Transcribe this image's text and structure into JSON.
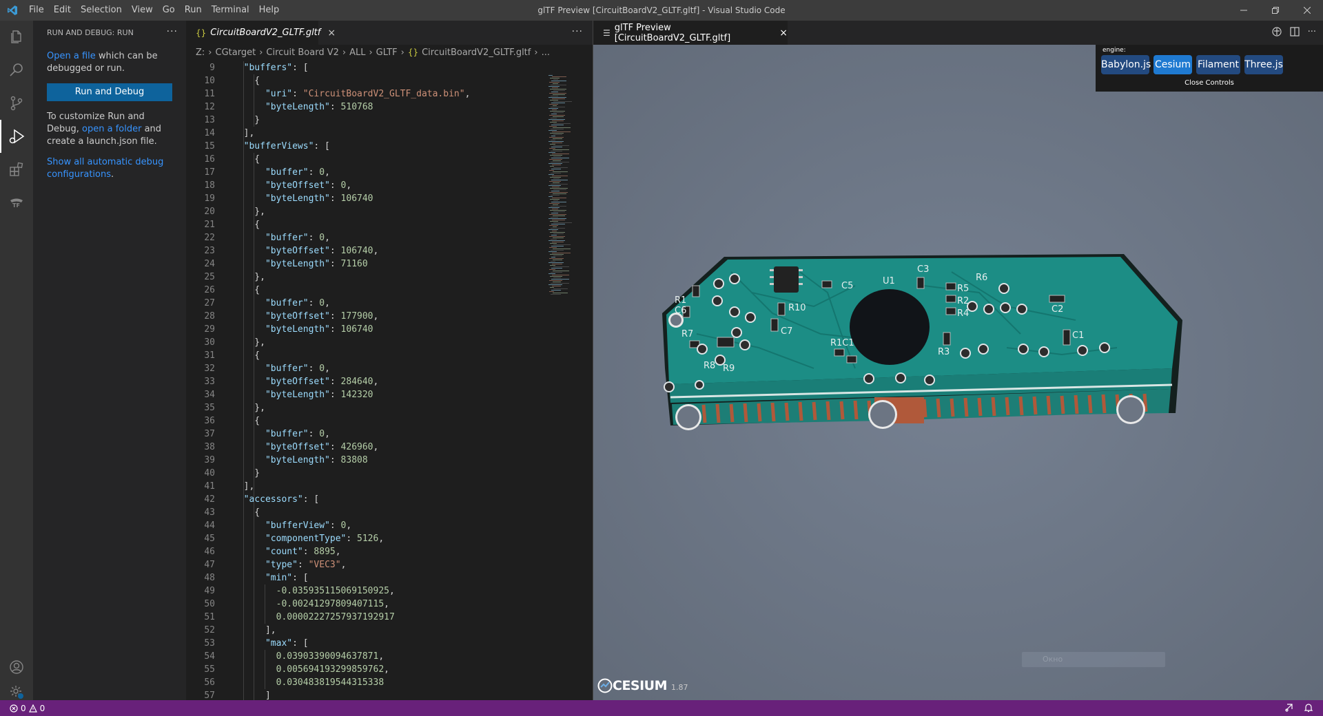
{
  "window": {
    "title": "glTF Preview [CircuitBoardV2_GLTF.gltf] - Visual Studio Code",
    "menu": [
      "File",
      "Edit",
      "Selection",
      "View",
      "Go",
      "Run",
      "Terminal",
      "Help"
    ]
  },
  "activity_bar": {
    "items": [
      "files-icon",
      "search-icon",
      "source-control-icon",
      "run-debug-icon",
      "extensions-icon",
      "gltf-icon"
    ],
    "bottom": [
      "account-icon",
      "settings-icon"
    ]
  },
  "sidebar": {
    "header": "RUN AND DEBUG: RUN",
    "open_file_link": "Open a file",
    "open_file_text": " which can be debugged or run.",
    "run_button": "Run and Debug",
    "customize_text_1": "To customize Run and Debug, ",
    "open_folder_link": "open a folder",
    "customize_text_2": " and create a launch.json file.",
    "show_all_link": "Show all automatic debug configurations",
    "show_all_end": "."
  },
  "editor": {
    "tab_label": "CircuitBoardV2_GLTF.gltf",
    "tab_icon": "{}",
    "breadcrumb": [
      "Z:",
      "CGtarget",
      "Circuit Board V2",
      "ALL",
      "GLTF",
      "CircuitBoardV2_GLTF.gltf",
      "..."
    ],
    "lines": [
      {
        "n": "9",
        "code": "  \"buffers\": ["
      },
      {
        "n": "10",
        "code": "    {"
      },
      {
        "n": "11",
        "code": "      \"uri\": \"CircuitBoardV2_GLTF_data.bin\","
      },
      {
        "n": "12",
        "code": "      \"byteLength\": 510768"
      },
      {
        "n": "13",
        "code": "    }"
      },
      {
        "n": "14",
        "code": "  ],"
      },
      {
        "n": "15",
        "code": "  \"bufferViews\": ["
      },
      {
        "n": "16",
        "code": "    {"
      },
      {
        "n": "17",
        "code": "      \"buffer\": 0,"
      },
      {
        "n": "18",
        "code": "      \"byteOffset\": 0,"
      },
      {
        "n": "19",
        "code": "      \"byteLength\": 106740"
      },
      {
        "n": "20",
        "code": "    },"
      },
      {
        "n": "21",
        "code": "    {"
      },
      {
        "n": "22",
        "code": "      \"buffer\": 0,"
      },
      {
        "n": "23",
        "code": "      \"byteOffset\": 106740,"
      },
      {
        "n": "24",
        "code": "      \"byteLength\": 71160"
      },
      {
        "n": "25",
        "code": "    },"
      },
      {
        "n": "26",
        "code": "    {"
      },
      {
        "n": "27",
        "code": "      \"buffer\": 0,"
      },
      {
        "n": "28",
        "code": "      \"byteOffset\": 177900,"
      },
      {
        "n": "29",
        "code": "      \"byteLength\": 106740"
      },
      {
        "n": "30",
        "code": "    },"
      },
      {
        "n": "31",
        "code": "    {"
      },
      {
        "n": "32",
        "code": "      \"buffer\": 0,"
      },
      {
        "n": "33",
        "code": "      \"byteOffset\": 284640,"
      },
      {
        "n": "34",
        "code": "      \"byteLength\": 142320"
      },
      {
        "n": "35",
        "code": "    },"
      },
      {
        "n": "36",
        "code": "    {"
      },
      {
        "n": "37",
        "code": "      \"buffer\": 0,"
      },
      {
        "n": "38",
        "code": "      \"byteOffset\": 426960,"
      },
      {
        "n": "39",
        "code": "      \"byteLength\": 83808"
      },
      {
        "n": "40",
        "code": "    }"
      },
      {
        "n": "41",
        "code": "  ],"
      },
      {
        "n": "42",
        "code": "  \"accessors\": ["
      },
      {
        "n": "43",
        "code": "    {"
      },
      {
        "n": "44",
        "code": "      \"bufferView\": 0,"
      },
      {
        "n": "45",
        "code": "      \"componentType\": 5126,"
      },
      {
        "n": "46",
        "code": "      \"count\": 8895,"
      },
      {
        "n": "47",
        "code": "      \"type\": \"VEC3\","
      },
      {
        "n": "48",
        "code": "      \"min\": ["
      },
      {
        "n": "49",
        "code": "        -0.035935115069150925,"
      },
      {
        "n": "50",
        "code": "        -0.00241297809407115,"
      },
      {
        "n": "51",
        "code": "        0.00002227257937192917"
      },
      {
        "n": "52",
        "code": "      ],"
      },
      {
        "n": "53",
        "code": "      \"max\": ["
      },
      {
        "n": "54",
        "code": "        0.03903390094637871,"
      },
      {
        "n": "55",
        "code": "        0.005694193299859762,"
      },
      {
        "n": "56",
        "code": "        0.030483819544315338"
      },
      {
        "n": "57",
        "code": "      ]"
      }
    ]
  },
  "preview": {
    "tab_label": "glTF Preview [CircuitBoardV2_GLTF.gltf]",
    "engine_label": "engine:",
    "engines": [
      "Babylon.js",
      "Cesium",
      "Filament",
      "Three.js"
    ],
    "selected_engine": "Cesium",
    "close_controls": "Close Controls",
    "cesium_logo": "CESIUM",
    "cesium_version": "1.87",
    "faint_input": "Окно",
    "pcb_labels": [
      "U1",
      "C3",
      "R6",
      "C5",
      "R10",
      "R1",
      "C6",
      "R5",
      "R2",
      "R4",
      "C7",
      "R7",
      "R1C1",
      "R3",
      "C1",
      "R8",
      "R9",
      "C2"
    ]
  },
  "status_bar": {
    "errors": "0",
    "warnings": "0"
  },
  "colors": {
    "titlebar": "#3c3c3c",
    "activitybar": "#333333",
    "sidebar": "#252526",
    "editor": "#1e1e1e",
    "statusbar": "#68217a",
    "button": "#0e639c",
    "link": "#3794ff",
    "viewport": "#6c7583",
    "pcb_green": "#1c8d85"
  }
}
